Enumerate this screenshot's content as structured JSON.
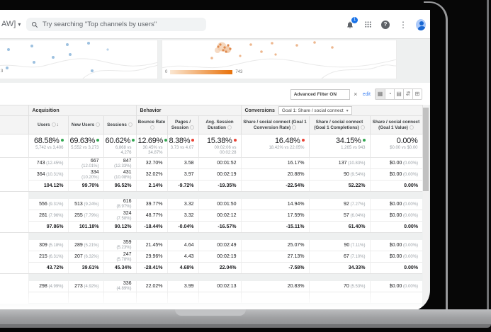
{
  "colors": {
    "accent": "#1a73e8",
    "positive": "#34a853",
    "negative": "#ea4335",
    "map_max_color": "#e8710a"
  },
  "icons": {
    "caret": "▾",
    "close": "×",
    "more": "⋮",
    "help": "?",
    "sort_desc": "↓",
    "view_table": "▦",
    "view_percentage": "◔",
    "view_performance": "▤",
    "view_comparison": "⇵",
    "view_pivot": "⊞"
  },
  "topbar": {
    "account": "AW]",
    "search_placeholder": "Try searching \"Top channels by users\"",
    "notification_count": "1",
    "icon_names": [
      "bell-icon",
      "apps-grid-icon",
      "help-icon",
      "more-icon",
      "avatar"
    ]
  },
  "panels": {
    "left_axis_label": "3",
    "legend_min": "0",
    "legend_max": "743"
  },
  "filter": {
    "label": "Advanced Filter ON",
    "edit_label": "edit"
  },
  "table": {
    "groups": {
      "acquisition": "Acquisition",
      "behavior": "Behavior",
      "conversions": "Conversions"
    },
    "goal_selector": "Goal 1: Share / social connect",
    "columns": [
      {
        "label": "Users",
        "sort": true
      },
      {
        "label": "New Users"
      },
      {
        "label": "Sessions"
      },
      {
        "label": "Bounce Rate"
      },
      {
        "label": "Pages / Session"
      },
      {
        "label": "Avg. Session Duration"
      },
      {
        "label": "Share / social connect (Goal 1 Conversion Rate)"
      },
      {
        "label": "Share / social connect (Goal 1 Completions)"
      },
      {
        "label": "Share / social connect (Goal 1 Value)"
      }
    ],
    "summary": [
      {
        "pct": "68.58%",
        "dir": "up",
        "sub": "5,742 vs 3,406"
      },
      {
        "pct": "69.63%",
        "dir": "up",
        "sub": "5,552 vs 3,273"
      },
      {
        "pct": "60.62%",
        "dir": "up",
        "sub": "6,868 vs 4,276"
      },
      {
        "pct": "12.69%",
        "dir": "up",
        "sub": "30.45% vs 34.87%"
      },
      {
        "pct": "8.38%",
        "dir": "down",
        "sub": "3.73 vs 4.07"
      },
      {
        "pct": "15.38%",
        "dir": "down",
        "sub": "00:02:06 vs 00:02:28"
      },
      {
        "pct": "16.48%",
        "dir": "down",
        "sub": "18.42% vs 22.05%"
      },
      {
        "pct": "34.15%",
        "dir": "up",
        "sub": "1,265 vs 943"
      },
      {
        "pct": "0.00%",
        "dir": "none",
        "sub": "$0.00 vs $0.00"
      }
    ],
    "row_groups": [
      {
        "rows": [
          [
            "743 (12.45%)",
            "667 (12.01%)",
            "847 (12.33%)",
            "32.70%",
            "3.58",
            "00:01:52",
            "16.17%",
            "137 (10.83%)",
            "$0.00 (0.00%)"
          ],
          [
            "364 (10.31%)",
            "334 (10.20%)",
            "431 (10.08%)",
            "32.02%",
            "3.97",
            "00:02:19",
            "20.88%",
            "90 (9.54%)",
            "$0.00 (0.00%)"
          ],
          [
            "104.12%",
            "99.70%",
            "96.52%",
            "2.14%",
            "-9.72%",
            "-19.35%",
            "-22.54%",
            "52.22%",
            "0.00%"
          ]
        ]
      },
      {
        "rows": [
          [
            "556 (9.31%)",
            "513 (9.24%)",
            "616 (8.97%)",
            "39.77%",
            "3.32",
            "00:01:50",
            "14.94%",
            "92 (7.27%)",
            "$0.00 (0.00%)"
          ],
          [
            "281 (7.96%)",
            "255 (7.79%)",
            "324 (7.58%)",
            "48.77%",
            "3.32",
            "00:02:12",
            "17.59%",
            "57 (6.04%)",
            "$0.00 (0.00%)"
          ],
          [
            "97.86%",
            "101.18%",
            "90.12%",
            "-18.44%",
            "-0.04%",
            "-16.57%",
            "-15.11%",
            "61.40%",
            "0.00%"
          ]
        ]
      },
      {
        "rows": [
          [
            "309 (5.18%)",
            "289 (5.21%)",
            "359 (5.23%)",
            "21.45%",
            "4.64",
            "00:02:49",
            "25.07%",
            "90 (7.11%)",
            "$0.00 (0.00%)"
          ],
          [
            "215 (6.31%)",
            "207 (6.32%)",
            "247 (5.78%)",
            "29.96%",
            "4.43",
            "00:02:19",
            "27.13%",
            "67 (7.10%)",
            "$0.00 (0.00%)"
          ],
          [
            "43.72%",
            "39.61%",
            "45.34%",
            "-28.41%",
            "4.68%",
            "22.04%",
            "-7.58%",
            "34.33%",
            "0.00%"
          ]
        ]
      },
      {
        "rows": [
          [
            "298 (4.99%)",
            "273 (4.92%)",
            "336 (4.89%)",
            "22.02%",
            "3.99",
            "00:02:13",
            "20.83%",
            "70 (5.53%)",
            "$0.00 (0.00%)"
          ]
        ]
      }
    ]
  }
}
